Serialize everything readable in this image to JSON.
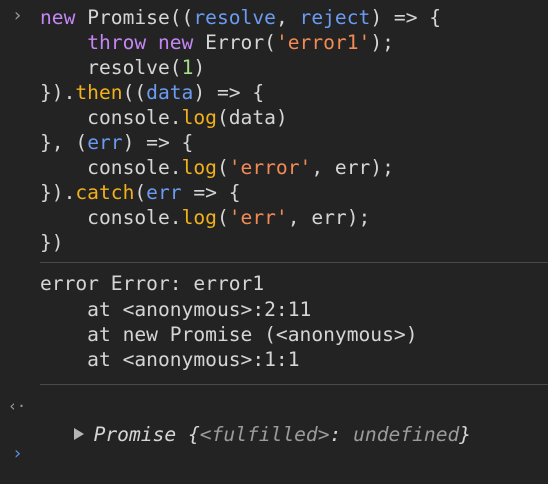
{
  "input": {
    "lines": [
      [
        {
          "t": "new ",
          "c": "kw"
        },
        {
          "t": "Promise((",
          "c": "def"
        },
        {
          "t": "resolve",
          "c": "param"
        },
        {
          "t": ", ",
          "c": "def"
        },
        {
          "t": "reject",
          "c": "param"
        },
        {
          "t": ") => {",
          "c": "def"
        }
      ],
      [
        {
          "t": "    ",
          "c": "def"
        },
        {
          "t": "throw ",
          "c": "kw"
        },
        {
          "t": "new ",
          "c": "kw"
        },
        {
          "t": "Error(",
          "c": "def"
        },
        {
          "t": "'error1'",
          "c": "str"
        },
        {
          "t": ");",
          "c": "def"
        }
      ],
      [
        {
          "t": "    resolve(",
          "c": "def"
        },
        {
          "t": "1",
          "c": "num"
        },
        {
          "t": ")",
          "c": "def"
        }
      ],
      [
        {
          "t": "}).",
          "c": "def"
        },
        {
          "t": "then",
          "c": "fn"
        },
        {
          "t": "((",
          "c": "def"
        },
        {
          "t": "data",
          "c": "param"
        },
        {
          "t": ") => {",
          "c": "def"
        }
      ],
      [
        {
          "t": "    console.",
          "c": "def"
        },
        {
          "t": "log",
          "c": "fn"
        },
        {
          "t": "(data)",
          "c": "def"
        }
      ],
      [
        {
          "t": "}, (",
          "c": "def"
        },
        {
          "t": "err",
          "c": "param"
        },
        {
          "t": ") => {",
          "c": "def"
        }
      ],
      [
        {
          "t": "    console.",
          "c": "def"
        },
        {
          "t": "log",
          "c": "fn"
        },
        {
          "t": "(",
          "c": "def"
        },
        {
          "t": "'error'",
          "c": "str"
        },
        {
          "t": ", err);",
          "c": "def"
        }
      ],
      [
        {
          "t": "}).",
          "c": "def"
        },
        {
          "t": "catch",
          "c": "fn"
        },
        {
          "t": "(",
          "c": "def"
        },
        {
          "t": "err",
          "c": "param"
        },
        {
          "t": " => {",
          "c": "def"
        }
      ],
      [
        {
          "t": "    console.",
          "c": "def"
        },
        {
          "t": "log",
          "c": "fn"
        },
        {
          "t": "(",
          "c": "def"
        },
        {
          "t": "'err'",
          "c": "str"
        },
        {
          "t": ", err);",
          "c": "def"
        }
      ],
      [
        {
          "t": "})",
          "c": "def"
        }
      ]
    ]
  },
  "error_output": {
    "lines": [
      "error Error: error1",
      "    at <anonymous>:2:11",
      "    at new Promise (<anonymous>)",
      "    at <anonymous>:1:1"
    ]
  },
  "result": {
    "name": "Promise ",
    "open": "{",
    "key": "<fulfilled>",
    "sep": ": ",
    "value": "undefined",
    "close": "}"
  },
  "prompts": {
    "input": "›",
    "result": "‹·",
    "next": "›"
  },
  "colors": {
    "background": "#232323",
    "keyword": "#c586f5",
    "function": "#f2b11c",
    "parameter": "#6b9bf2",
    "string": "#f28b54",
    "number": "#a8dd8c",
    "text": "#d5d5d5"
  }
}
